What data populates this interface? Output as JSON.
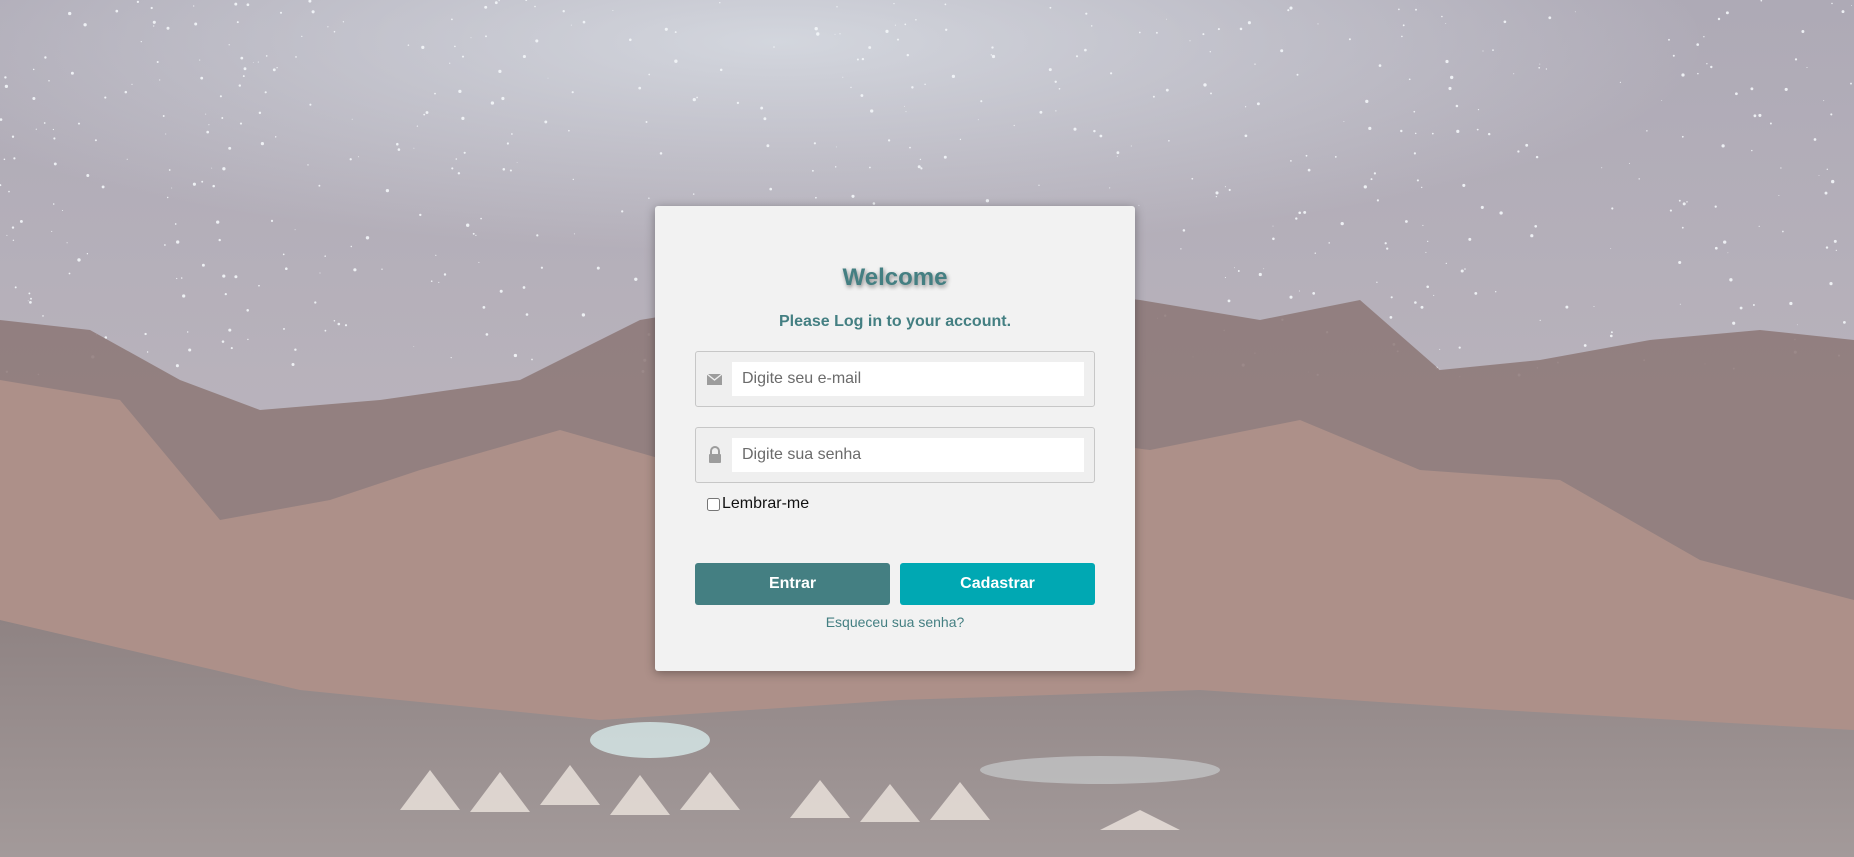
{
  "background": {
    "description_icon": "starry-night-mountains-image",
    "sky_color": "#b9b3bd",
    "mountain_color": "#a8938f"
  },
  "login": {
    "title": "Welcome",
    "subtitle": "Please Log in to your account.",
    "email": {
      "icon": "envelope-icon",
      "placeholder": "Digite seu e-mail",
      "value": ""
    },
    "password": {
      "icon": "lock-icon",
      "placeholder": "Digite sua senha",
      "value": ""
    },
    "remember_label": "Lembrar-me",
    "remember_checked": false,
    "login_button": "Entrar",
    "register_button": "Cadastrar",
    "forgot_link": "Esqueceu sua senha?",
    "colors": {
      "primary": "#447f82",
      "secondary": "#00a8b3",
      "card": "#f2f2f2"
    }
  }
}
